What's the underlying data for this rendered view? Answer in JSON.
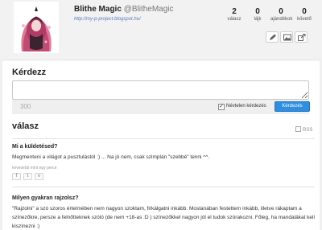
{
  "profile": {
    "name": "Blithe Magic",
    "handle": "@BlitheMagic",
    "link": "http://my-p-project.blogspot.hu/"
  },
  "stats": [
    {
      "value": "2",
      "label": "válasz"
    },
    {
      "value": "0",
      "label": "lájk"
    },
    {
      "value": "0",
      "label": "ajándékok"
    },
    {
      "value": "0",
      "label": "követő"
    }
  ],
  "header_icons": [
    "pencil-icon",
    "image-icon",
    "share-icon"
  ],
  "ask": {
    "title": "Kérdezz",
    "char_count": "300",
    "anonymous_label": "Névtelen kérdezés",
    "anonymous_checked": true,
    "submit_label": "Kérdezés"
  },
  "answers": {
    "title": "válasz",
    "rss_label": "RSS",
    "items": [
      {
        "question": "Mi a küldetésed?",
        "answer": "Megmenteni a világot a pusztulástól :) ... Na jó nem, csak szimplán \"szebbé\" tenni ^^.",
        "time": "kevesebb mint egy perce"
      },
      {
        "question": "Milyen gyakran rajzolsz?",
        "answer": "\"Rajzolni\" a szó szoros értelmében nem nagyon szoktam, firkálgatni inkább. Mostanában festettem inkább, illetve rákaptam a színezőkre, persze a felnőtteknek szóló (de nem +18-as :D ) színezőkkel nagyon jól el tudok szórakozni. Főleg, ha mandalákat kell kiszínezni :)"
      }
    ]
  },
  "colors": {
    "accent": "#2e8fe0",
    "link": "#5a7ab8",
    "background": "#f0f0f0"
  }
}
